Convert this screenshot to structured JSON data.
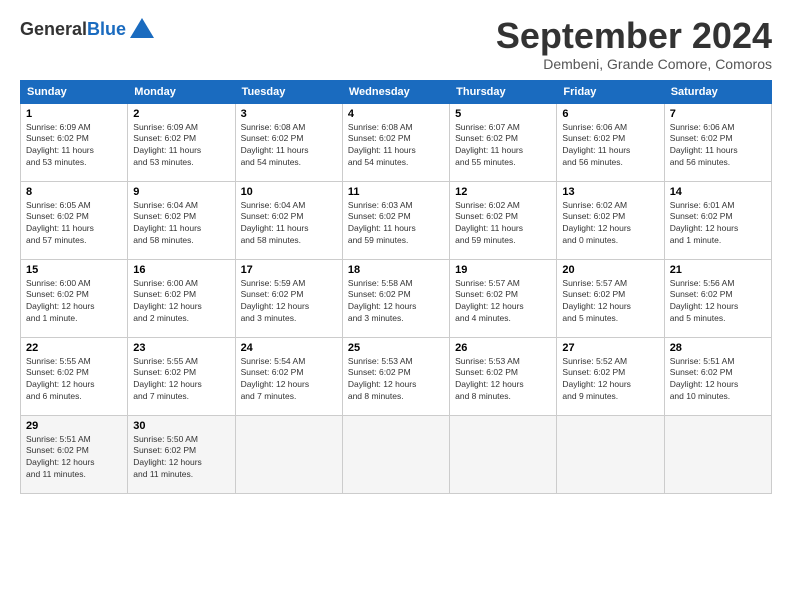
{
  "logo": {
    "general": "General",
    "blue": "Blue"
  },
  "title": "September 2024",
  "location": "Dembeni, Grande Comore, Comoros",
  "days_of_week": [
    "Sunday",
    "Monday",
    "Tuesday",
    "Wednesday",
    "Thursday",
    "Friday",
    "Saturday"
  ],
  "weeks": [
    [
      {
        "day": "1",
        "info": "Sunrise: 6:09 AM\nSunset: 6:02 PM\nDaylight: 11 hours\nand 53 minutes."
      },
      {
        "day": "2",
        "info": "Sunrise: 6:09 AM\nSunset: 6:02 PM\nDaylight: 11 hours\nand 53 minutes."
      },
      {
        "day": "3",
        "info": "Sunrise: 6:08 AM\nSunset: 6:02 PM\nDaylight: 11 hours\nand 54 minutes."
      },
      {
        "day": "4",
        "info": "Sunrise: 6:08 AM\nSunset: 6:02 PM\nDaylight: 11 hours\nand 54 minutes."
      },
      {
        "day": "5",
        "info": "Sunrise: 6:07 AM\nSunset: 6:02 PM\nDaylight: 11 hours\nand 55 minutes."
      },
      {
        "day": "6",
        "info": "Sunrise: 6:06 AM\nSunset: 6:02 PM\nDaylight: 11 hours\nand 56 minutes."
      },
      {
        "day": "7",
        "info": "Sunrise: 6:06 AM\nSunset: 6:02 PM\nDaylight: 11 hours\nand 56 minutes."
      }
    ],
    [
      {
        "day": "8",
        "info": "Sunrise: 6:05 AM\nSunset: 6:02 PM\nDaylight: 11 hours\nand 57 minutes."
      },
      {
        "day": "9",
        "info": "Sunrise: 6:04 AM\nSunset: 6:02 PM\nDaylight: 11 hours\nand 58 minutes."
      },
      {
        "day": "10",
        "info": "Sunrise: 6:04 AM\nSunset: 6:02 PM\nDaylight: 11 hours\nand 58 minutes."
      },
      {
        "day": "11",
        "info": "Sunrise: 6:03 AM\nSunset: 6:02 PM\nDaylight: 11 hours\nand 59 minutes."
      },
      {
        "day": "12",
        "info": "Sunrise: 6:02 AM\nSunset: 6:02 PM\nDaylight: 11 hours\nand 59 minutes."
      },
      {
        "day": "13",
        "info": "Sunrise: 6:02 AM\nSunset: 6:02 PM\nDaylight: 12 hours\nand 0 minutes."
      },
      {
        "day": "14",
        "info": "Sunrise: 6:01 AM\nSunset: 6:02 PM\nDaylight: 12 hours\nand 1 minute."
      }
    ],
    [
      {
        "day": "15",
        "info": "Sunrise: 6:00 AM\nSunset: 6:02 PM\nDaylight: 12 hours\nand 1 minute."
      },
      {
        "day": "16",
        "info": "Sunrise: 6:00 AM\nSunset: 6:02 PM\nDaylight: 12 hours\nand 2 minutes."
      },
      {
        "day": "17",
        "info": "Sunrise: 5:59 AM\nSunset: 6:02 PM\nDaylight: 12 hours\nand 3 minutes."
      },
      {
        "day": "18",
        "info": "Sunrise: 5:58 AM\nSunset: 6:02 PM\nDaylight: 12 hours\nand 3 minutes."
      },
      {
        "day": "19",
        "info": "Sunrise: 5:57 AM\nSunset: 6:02 PM\nDaylight: 12 hours\nand 4 minutes."
      },
      {
        "day": "20",
        "info": "Sunrise: 5:57 AM\nSunset: 6:02 PM\nDaylight: 12 hours\nand 5 minutes."
      },
      {
        "day": "21",
        "info": "Sunrise: 5:56 AM\nSunset: 6:02 PM\nDaylight: 12 hours\nand 5 minutes."
      }
    ],
    [
      {
        "day": "22",
        "info": "Sunrise: 5:55 AM\nSunset: 6:02 PM\nDaylight: 12 hours\nand 6 minutes."
      },
      {
        "day": "23",
        "info": "Sunrise: 5:55 AM\nSunset: 6:02 PM\nDaylight: 12 hours\nand 7 minutes."
      },
      {
        "day": "24",
        "info": "Sunrise: 5:54 AM\nSunset: 6:02 PM\nDaylight: 12 hours\nand 7 minutes."
      },
      {
        "day": "25",
        "info": "Sunrise: 5:53 AM\nSunset: 6:02 PM\nDaylight: 12 hours\nand 8 minutes."
      },
      {
        "day": "26",
        "info": "Sunrise: 5:53 AM\nSunset: 6:02 PM\nDaylight: 12 hours\nand 8 minutes."
      },
      {
        "day": "27",
        "info": "Sunrise: 5:52 AM\nSunset: 6:02 PM\nDaylight: 12 hours\nand 9 minutes."
      },
      {
        "day": "28",
        "info": "Sunrise: 5:51 AM\nSunset: 6:02 PM\nDaylight: 12 hours\nand 10 minutes."
      }
    ],
    [
      {
        "day": "29",
        "info": "Sunrise: 5:51 AM\nSunset: 6:02 PM\nDaylight: 12 hours\nand 11 minutes."
      },
      {
        "day": "30",
        "info": "Sunrise: 5:50 AM\nSunset: 6:02 PM\nDaylight: 12 hours\nand 11 minutes."
      },
      {
        "day": "",
        "info": ""
      },
      {
        "day": "",
        "info": ""
      },
      {
        "day": "",
        "info": ""
      },
      {
        "day": "",
        "info": ""
      },
      {
        "day": "",
        "info": ""
      }
    ]
  ]
}
